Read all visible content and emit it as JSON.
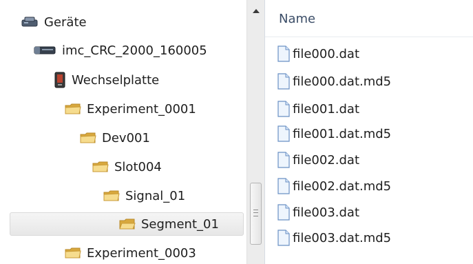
{
  "tree": {
    "items": [
      {
        "label": "Geräte",
        "icon": "devices-icon"
      },
      {
        "label": "imc_CRC_2000_160005",
        "icon": "device-icon"
      },
      {
        "label": "Wechselplatte",
        "icon": "removable-disk-icon"
      },
      {
        "label": "Experiment_0001",
        "icon": "folder-icon"
      },
      {
        "label": "Dev001",
        "icon": "folder-icon"
      },
      {
        "label": "Slot004",
        "icon": "folder-icon"
      },
      {
        "label": "Signal_01",
        "icon": "folder-icon"
      },
      {
        "label": "Segment_01",
        "icon": "folder-open-icon",
        "selected": true
      },
      {
        "label": "Experiment_0003",
        "icon": "folder-icon"
      }
    ]
  },
  "file_list": {
    "column_header": "Name",
    "files": [
      {
        "name": "file000.dat",
        "icon": "file-icon"
      },
      {
        "name": "file000.dat.md5",
        "icon": "file-icon"
      },
      {
        "name": "file001.dat",
        "icon": "file-icon"
      },
      {
        "name": "file001.dat.md5",
        "icon": "file-icon"
      },
      {
        "name": "file002.dat",
        "icon": "file-icon"
      },
      {
        "name": "file002.dat.md5",
        "icon": "file-icon"
      },
      {
        "name": "file003.dat",
        "icon": "file-icon"
      },
      {
        "name": "file003.dat.md5",
        "icon": "file-icon"
      }
    ]
  },
  "colors": {
    "folder": "#f2d27a",
    "folder_dark": "#d8a83e",
    "file_border": "#6a90c4",
    "file_fill": "#eef5fd",
    "selection_border": "#d9d9d9",
    "header_text": "#3b4d67"
  }
}
